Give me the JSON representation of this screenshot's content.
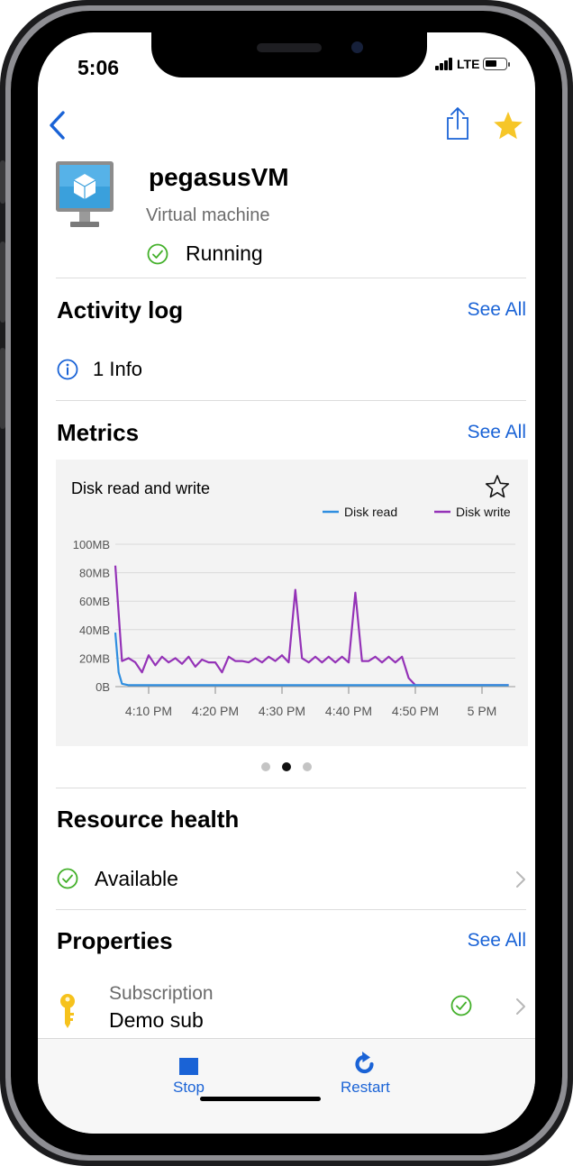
{
  "status_bar": {
    "time": "5:06",
    "network": "LTE"
  },
  "nav": {
    "back_icon": "chevron-left-icon",
    "share_icon": "share-icon",
    "favorite_icon": "star-filled-icon"
  },
  "resource": {
    "name": "pegasusVM",
    "type": "Virtual machine",
    "status": "Running",
    "icon": "virtual-machine-icon"
  },
  "activity_log": {
    "title": "Activity log",
    "see_all": "See All",
    "summary": "1 Info"
  },
  "metrics": {
    "title": "Metrics",
    "see_all": "See All",
    "page_count": 3,
    "active_page": 2
  },
  "chart_data": {
    "type": "line",
    "title": "Disk read and write",
    "xlabel": "",
    "ylabel": "",
    "y_tick_labels": [
      "100MB",
      "80MB",
      "60MB",
      "40MB",
      "20MB",
      "0B"
    ],
    "y_ticks": [
      100,
      80,
      60,
      40,
      20,
      0
    ],
    "x_tick_labels": [
      "4:10 PM",
      "4:20 PM",
      "4:30 PM",
      "4:40 PM",
      "4:50 PM",
      "5 PM"
    ],
    "x_ticks": [
      10,
      20,
      30,
      40,
      50,
      60
    ],
    "xlim": [
      5,
      65
    ],
    "ylim": [
      0,
      100
    ],
    "grid": true,
    "legend_position": "top-right",
    "series": [
      {
        "name": "Disk read",
        "color": "#2f8ee0",
        "x": [
          5,
          5.5,
          6,
          7,
          10,
          15,
          20,
          25,
          30,
          35,
          40,
          45,
          50,
          55,
          60,
          64
        ],
        "y": [
          38,
          10,
          2,
          1,
          1,
          1,
          1,
          1,
          1,
          1,
          1,
          1,
          1,
          1,
          1,
          1
        ]
      },
      {
        "name": "Disk write",
        "color": "#9432b7",
        "x": [
          5,
          6,
          7,
          8,
          9,
          10,
          11,
          12,
          13,
          14,
          15,
          16,
          17,
          18,
          19,
          20,
          21,
          22,
          23,
          24,
          25,
          26,
          27,
          28,
          29,
          30,
          31,
          32,
          33,
          34,
          35,
          36,
          37,
          38,
          39,
          40,
          41,
          42,
          43,
          44,
          45,
          46,
          47,
          48,
          49,
          50,
          55,
          60,
          64
        ],
        "y": [
          85,
          18,
          20,
          17,
          10,
          22,
          15,
          21,
          17,
          20,
          16,
          21,
          14,
          19,
          17,
          17,
          10,
          21,
          18,
          18,
          17,
          20,
          17,
          21,
          18,
          22,
          17,
          68,
          20,
          17,
          21,
          17,
          21,
          17,
          21,
          17,
          66,
          18,
          18,
          21,
          17,
          21,
          17,
          21,
          6,
          1,
          1,
          1,
          1
        ]
      }
    ]
  },
  "resource_health": {
    "title": "Resource health",
    "status": "Available"
  },
  "properties": {
    "title": "Properties",
    "see_all": "See All",
    "items": [
      {
        "label": "Subscription",
        "value": "Demo sub",
        "icon": "key-icon"
      }
    ]
  },
  "tabbar": {
    "stop_label": "Stop",
    "restart_label": "Restart"
  },
  "colors": {
    "accent": "#1a63d6",
    "success": "#43b02a",
    "star": "#f6c628"
  }
}
